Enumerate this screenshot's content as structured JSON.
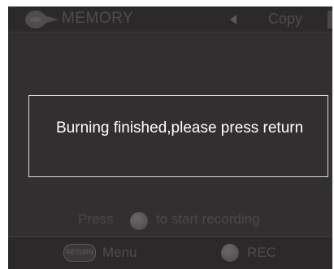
{
  "header": {
    "title": "MEMORY",
    "mode_label": "Copy"
  },
  "dialog": {
    "message": "Burning finished,please press return"
  },
  "prompt": {
    "before": "Press",
    "after": "to start recording"
  },
  "footer": {
    "return_button_label": "RETURN",
    "menu_label": "Menu",
    "rec_label": "REC"
  },
  "colors": {
    "screen_background": "#312f30",
    "dimmed_text": "#4e4c4d",
    "message_text": "#ffffff",
    "dialog_border": "#dcdcdc"
  }
}
